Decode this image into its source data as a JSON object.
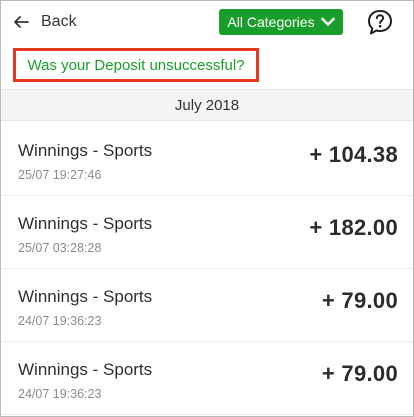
{
  "header": {
    "back_label": "Back",
    "category_label": "All Categories",
    "help_icon": "question-bubble-icon",
    "back_icon": "arrow-left-icon",
    "dropdown_icon": "chevron-down-icon"
  },
  "banner": {
    "deposit_link": "Was your Deposit unsuccessful?"
  },
  "month": "July 2018",
  "transactions": [
    {
      "title": "Winnings - Sports",
      "time": "25/07 19:27:46",
      "amount": "+ 104.38"
    },
    {
      "title": "Winnings - Sports",
      "time": "25/07 03:28:28",
      "amount": "+ 182.00"
    },
    {
      "title": "Winnings - Sports",
      "time": "24/07 19:36:23",
      "amount": "+ 79.00"
    },
    {
      "title": "Winnings - Sports",
      "time": "24/07 19:36:23",
      "amount": "+ 79.00"
    }
  ],
  "colors": {
    "brand_green": "#1a9e2b",
    "highlight_red": "#e5371f",
    "month_bg": "#f4f4f4"
  }
}
